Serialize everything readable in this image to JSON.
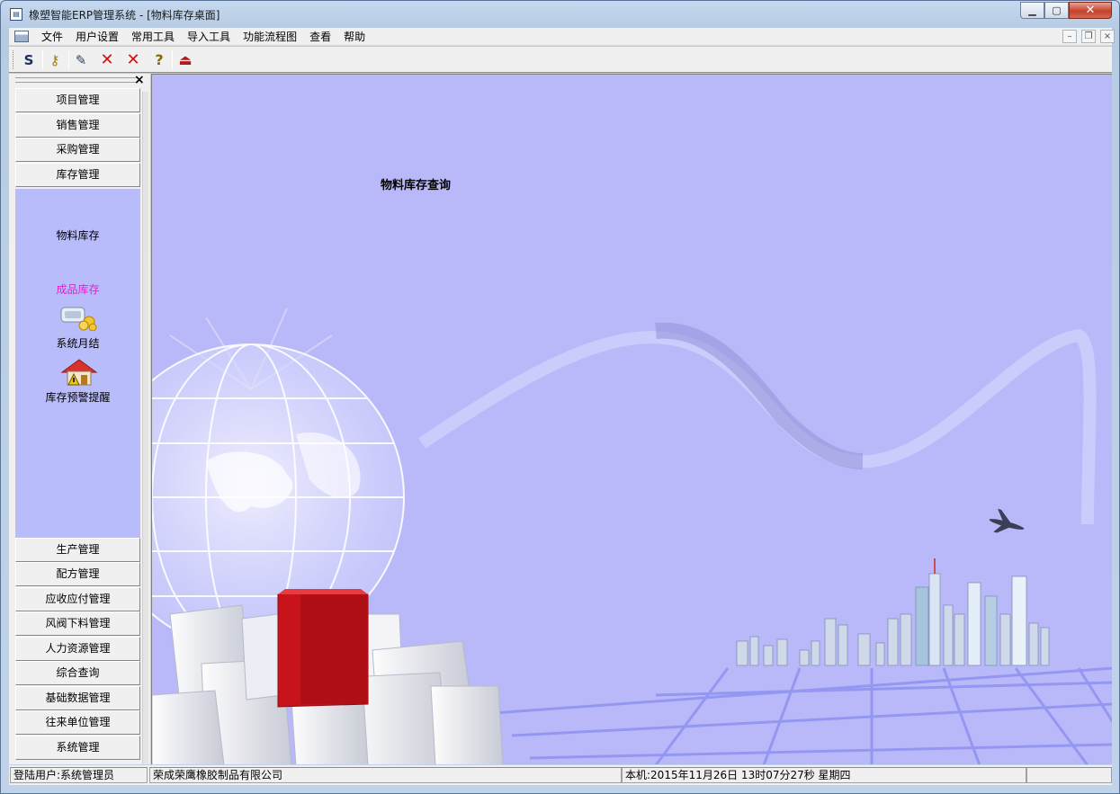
{
  "window": {
    "title": "橡塑智能ERP管理系统 - [物料库存桌面]",
    "minimize": "▁",
    "maximize": "▢",
    "close": "✕"
  },
  "menubar": {
    "items": [
      "文件",
      "用户设置",
      "常用工具",
      "导入工具",
      "功能流程图",
      "查看",
      "帮助"
    ],
    "mdi_min": "–",
    "mdi_restore": "❐",
    "mdi_close": "×"
  },
  "toolbar": {
    "buttons": [
      {
        "icon": "swap-icon",
        "glyph": "Ѕ"
      },
      {
        "icon": "key-icon",
        "glyph": "⚷"
      },
      {
        "icon": "pipette-icon",
        "glyph": "✎"
      },
      {
        "icon": "delete-icon",
        "glyph": "✕"
      },
      {
        "icon": "cancel-icon",
        "glyph": "✕"
      },
      {
        "icon": "help-icon",
        "glyph": "?"
      },
      {
        "icon": "exit-icon",
        "glyph": "⏏"
      }
    ]
  },
  "sidebar": {
    "close": "×",
    "top_groups": [
      "项目管理",
      "销售管理",
      "采购管理",
      "库存管理"
    ],
    "panel_items": [
      "物料库存",
      "成品库存",
      "系统月结",
      "库存预警提醒"
    ],
    "bottom_groups": [
      "生产管理",
      "配方管理",
      "应收应付管理",
      "风阀下料管理",
      "人力资源管理",
      "综合查询",
      "基础数据管理",
      "往来单位管理",
      "系统管理"
    ]
  },
  "content": {
    "heading": "物料库存查询"
  },
  "statusbar": {
    "user": "登陆用户:系统管理员",
    "company": "荣成荣鹰橡胶制品有限公司",
    "datetime": "本机:2015年11月26日  13时07分27秒  星期四"
  },
  "colors": {
    "content_bg": "#b9b9f9",
    "panel_bg": "#b9bcfa",
    "selected_item": "#e020d0",
    "close_red": "#c4412b"
  }
}
